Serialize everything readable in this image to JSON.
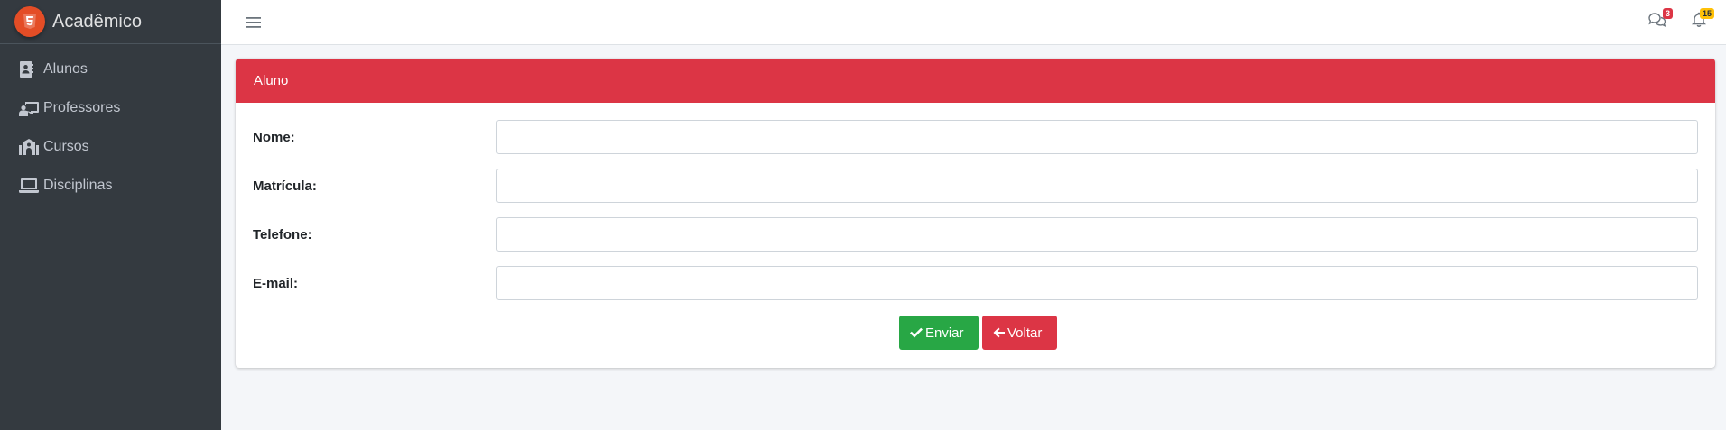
{
  "brand": {
    "name": "Acadêmico",
    "logo_icon": "html5-icon",
    "logo_color": "#e44d26"
  },
  "sidebar": {
    "items": [
      {
        "label": "Alunos",
        "icon": "address-book-icon"
      },
      {
        "label": "Professores",
        "icon": "chalkboard-teacher-icon"
      },
      {
        "label": "Cursos",
        "icon": "school-icon"
      },
      {
        "label": "Disciplinas",
        "icon": "laptop-icon"
      }
    ]
  },
  "topbar": {
    "messages_badge": "3",
    "notifications_badge": "15"
  },
  "card": {
    "title": "Aluno",
    "fields": [
      {
        "label": "Nome:",
        "value": ""
      },
      {
        "label": "Matrícula:",
        "value": ""
      },
      {
        "label": "Telefone:",
        "value": ""
      },
      {
        "label": "E-mail:",
        "value": ""
      }
    ],
    "submit_label": "Enviar",
    "back_label": "Voltar"
  },
  "colors": {
    "sidebar_bg": "#343a40",
    "header_red": "#dc3545",
    "success_green": "#28a745",
    "warning_yellow": "#ffc107"
  }
}
